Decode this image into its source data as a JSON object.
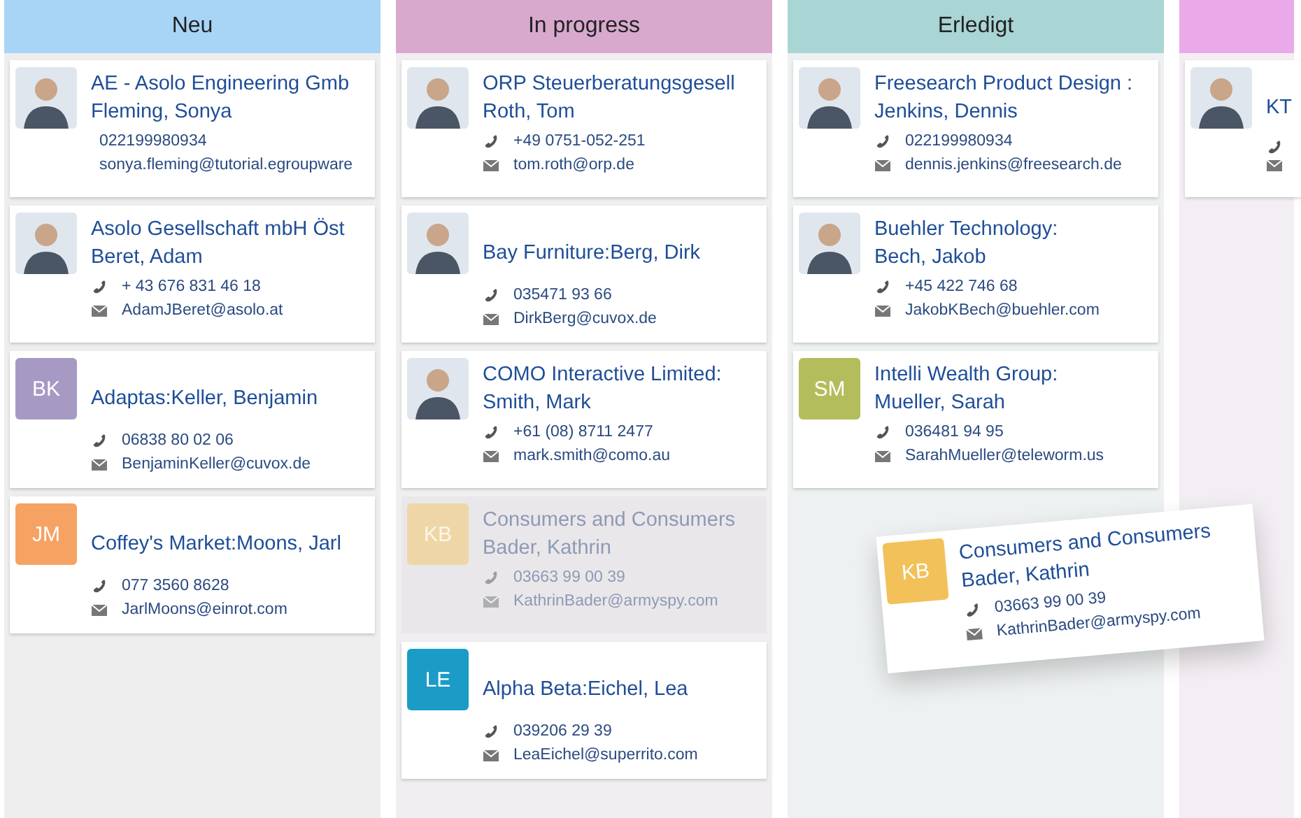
{
  "columns": [
    {
      "title": "Neu",
      "color": "#a8d4f6",
      "cards": [
        {
          "kind": "card",
          "avatar": {
            "kind": "photo"
          },
          "lines": [
            "AE - Asolo Engineering Gmb",
            "Fleming, Sonya"
          ],
          "icons": false,
          "phone": "022199980934",
          "email": "sonya.fleming@tutorial.egroupware"
        },
        {
          "kind": "card",
          "avatar": {
            "kind": "photo"
          },
          "lines": [
            "Asolo Gesellschaft mbH Öst",
            "Beret, Adam"
          ],
          "icons": true,
          "phone": "+ 43 676 831 46 18",
          "email": "AdamJBeret@asolo.at"
        },
        {
          "kind": "card",
          "avatar": {
            "kind": "initials",
            "initials": "BK",
            "color": "#a69ac4"
          },
          "lines": [
            "Adaptas:Keller, Benjamin"
          ],
          "icons": true,
          "phone": "06838 80 02 06",
          "email": "BenjaminKeller@cuvox.de"
        },
        {
          "kind": "card",
          "avatar": {
            "kind": "initials",
            "initials": "JM",
            "color": "#f5a263"
          },
          "lines": [
            "Coffey's Market:Moons, Jarl"
          ],
          "icons": true,
          "phone": "077 3560 8628",
          "email": "JarlMoons@einrot.com"
        }
      ]
    },
    {
      "title": "In progress",
      "color": "#d9a9cd",
      "cards": [
        {
          "kind": "card",
          "avatar": {
            "kind": "photo"
          },
          "lines": [
            "ORP Steuerberatungsgesell",
            "Roth, Tom"
          ],
          "icons": true,
          "phone": "+49 0751-052-251",
          "email": "tom.roth@orp.de"
        },
        {
          "kind": "card",
          "avatar": {
            "kind": "photo"
          },
          "lines": [
            "Bay Furniture:Berg, Dirk"
          ],
          "icons": true,
          "phone": "035471 93 66",
          "email": "DirkBerg@cuvox.de"
        },
        {
          "kind": "card",
          "avatar": {
            "kind": "photo"
          },
          "lines": [
            "COMO Interactive Limited:",
            "Smith, Mark"
          ],
          "icons": true,
          "phone": "+61 (08) 8711 2477",
          "email": "mark.smith@como.au"
        },
        {
          "kind": "ghost",
          "avatar": {
            "kind": "initials",
            "initials": "KB",
            "color": "#efd6a6"
          },
          "lines": [
            "Consumers and Consumers",
            "Bader, Kathrin"
          ],
          "icons": true,
          "phone": "03663 99 00 39",
          "email": "KathrinBader@armyspy.com"
        },
        {
          "kind": "card",
          "avatar": {
            "kind": "initials",
            "initials": "LE",
            "color": "#1a9cc7"
          },
          "lines": [
            "Alpha Beta:Eichel, Lea"
          ],
          "icons": true,
          "phone": "039206 29 39",
          "email": "LeaEichel@superrito.com"
        }
      ]
    },
    {
      "title": "Erledigt",
      "color": "#a9d5d4",
      "cards": [
        {
          "kind": "card",
          "avatar": {
            "kind": "photo"
          },
          "lines": [
            "Freesearch Product Design :",
            "Jenkins, Dennis"
          ],
          "icons": true,
          "phone": "022199980934",
          "email": "dennis.jenkins@freesearch.de"
        },
        {
          "kind": "card",
          "avatar": {
            "kind": "photo"
          },
          "lines": [
            "Buehler Technology:",
            "Bech, Jakob"
          ],
          "icons": true,
          "phone": "+45 422 746 68",
          "email": "JakobKBech@buehler.com"
        },
        {
          "kind": "card",
          "avatar": {
            "kind": "initials",
            "initials": "SM",
            "color": "#b4bd5c"
          },
          "lines": [
            "Intelli Wealth Group:",
            "Mueller, Sarah"
          ],
          "icons": true,
          "phone": "036481 94 95",
          "email": "SarahMueller@teleworm.us"
        }
      ]
    },
    {
      "color": "#eaa9e8",
      "cards": [
        {
          "kind": "card",
          "avatar": {
            "kind": "photo"
          },
          "lines": [
            "KT"
          ],
          "icons": true
        }
      ]
    }
  ],
  "dragged_card": {
    "avatar": {
      "kind": "initials",
      "initials": "KB",
      "color": "#f2c15a"
    },
    "lines": [
      "Consumers and Consumers",
      "Bader, Kathrin"
    ],
    "icons": true,
    "phone": "03663 99 00 39",
    "email": "KathrinBader@armyspy.com"
  }
}
